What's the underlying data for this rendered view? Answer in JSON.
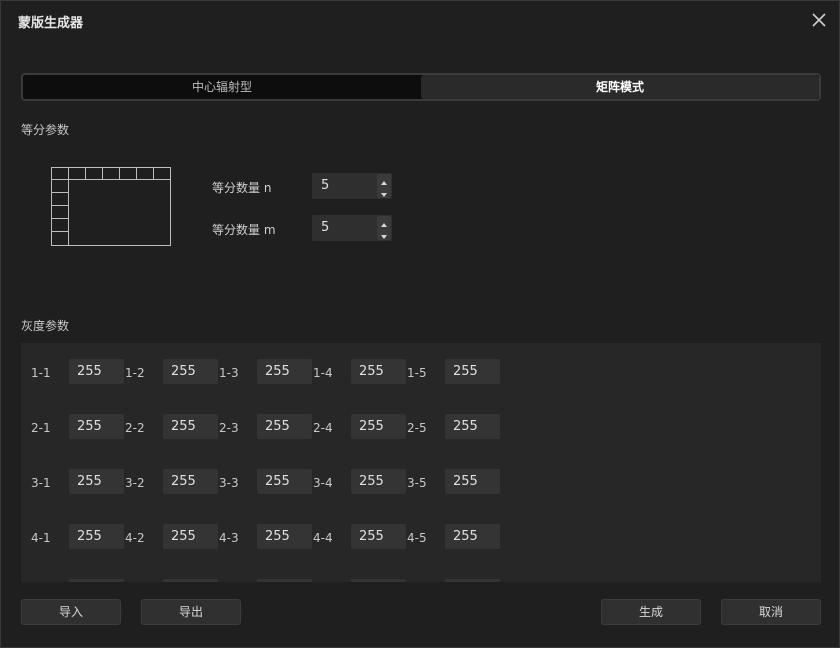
{
  "dialog": {
    "title": "蒙版生成器"
  },
  "mode_tabs": [
    {
      "label": "中心辐射型",
      "active": false
    },
    {
      "label": "矩阵模式",
      "active": true
    }
  ],
  "division": {
    "section_label": "等分参数",
    "n_label": "等分数量 n",
    "n_value": "5",
    "m_label": "等分数量 m",
    "m_value": "5"
  },
  "gray": {
    "section_label": "灰度参数",
    "rows": [
      {
        "cells": [
          {
            "label": "1-1",
            "value": "255"
          },
          {
            "label": "1-2",
            "value": "255"
          },
          {
            "label": "1-3",
            "value": "255"
          },
          {
            "label": "1-4",
            "value": "255"
          },
          {
            "label": "1-5",
            "value": "255"
          }
        ]
      },
      {
        "cells": [
          {
            "label": "2-1",
            "value": "255"
          },
          {
            "label": "2-2",
            "value": "255"
          },
          {
            "label": "2-3",
            "value": "255"
          },
          {
            "label": "2-4",
            "value": "255"
          },
          {
            "label": "2-5",
            "value": "255"
          }
        ]
      },
      {
        "cells": [
          {
            "label": "3-1",
            "value": "255"
          },
          {
            "label": "3-2",
            "value": "255"
          },
          {
            "label": "3-3",
            "value": "255"
          },
          {
            "label": "3-4",
            "value": "255"
          },
          {
            "label": "3-5",
            "value": "255"
          }
        ]
      },
      {
        "cells": [
          {
            "label": "4-1",
            "value": "255"
          },
          {
            "label": "4-2",
            "value": "255"
          },
          {
            "label": "4-3",
            "value": "255"
          },
          {
            "label": "4-4",
            "value": "255"
          },
          {
            "label": "4-5",
            "value": "255"
          }
        ]
      }
    ]
  },
  "footer": {
    "import_label": "导入",
    "export_label": "导出",
    "generate_label": "生成",
    "cancel_label": "取消"
  }
}
